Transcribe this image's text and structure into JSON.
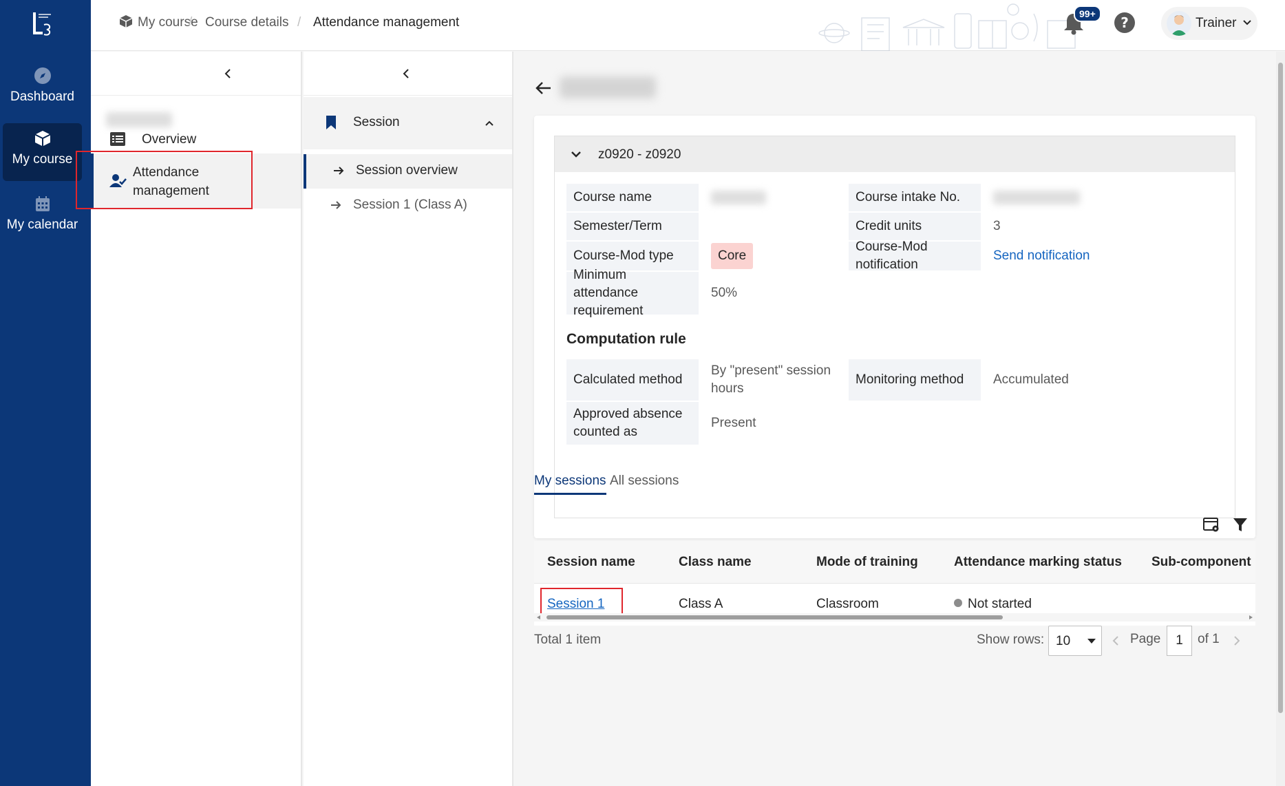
{
  "nav": {
    "logo_text": "LE",
    "items": [
      {
        "label": "Dashboard",
        "icon": "compass-icon"
      },
      {
        "label": "My course",
        "icon": "cube-icon"
      },
      {
        "label": "My calendar",
        "icon": "calendar-icon"
      }
    ]
  },
  "header": {
    "breadcrumbs": [
      "My course",
      "Course details",
      "Attendance management"
    ],
    "separator": "/",
    "notification_badge": "99+",
    "user_name": "Trainer"
  },
  "panel1": {
    "items": [
      {
        "label": "Overview",
        "icon": "list-icon"
      },
      {
        "label": "Attendance management",
        "icon": "user-check-icon",
        "selected": true
      }
    ]
  },
  "panel2": {
    "section_label": "Session",
    "items": [
      {
        "label": "Session overview",
        "selected": true
      },
      {
        "label": "Session 1 (Class A)",
        "selected": false
      }
    ]
  },
  "main": {
    "group_title": "z0920 - z0920",
    "fields": {
      "course_name_label": "Course name",
      "course_intake_label": "Course intake No.",
      "semester_label": "Semester/Term",
      "credit_units_label": "Credit units",
      "credit_units_value": "3",
      "mod_type_label": "Course-Mod type",
      "mod_type_value": "Core",
      "mod_notification_label": "Course-Mod notification",
      "mod_notification_link": "Send notification",
      "min_attendance_label": "Minimum attendance requirement",
      "min_attendance_value": "50%"
    },
    "computation": {
      "title": "Computation rule",
      "calc_method_label": "Calculated method",
      "calc_method_value": "By \"present\" session hours",
      "monitor_label": "Monitoring method",
      "monitor_value": "Accumulated",
      "absence_label": "Approved absence counted as",
      "absence_value": "Present"
    },
    "tabs": [
      "My sessions",
      "All sessions"
    ],
    "table": {
      "headers": [
        "Session name",
        "Class name",
        "Mode of training",
        "Attendance marking status",
        "Sub-component"
      ],
      "rows": [
        {
          "session_name": "Session 1",
          "class_name": "Class A",
          "mode": "Classroom",
          "status": "Not started",
          "sub_component": ""
        }
      ]
    },
    "pagination": {
      "total": "Total 1 item",
      "show_rows_label": "Show rows:",
      "rows_value": "10",
      "page_label": "Page",
      "page_value": "1",
      "of_label": "of 1"
    }
  },
  "colors": {
    "nav_bg": "#0c3778",
    "accent": "#0c3778",
    "link": "#1565c0",
    "highlight_box": "#e0262c",
    "core_tag": "#fbd3d1"
  }
}
